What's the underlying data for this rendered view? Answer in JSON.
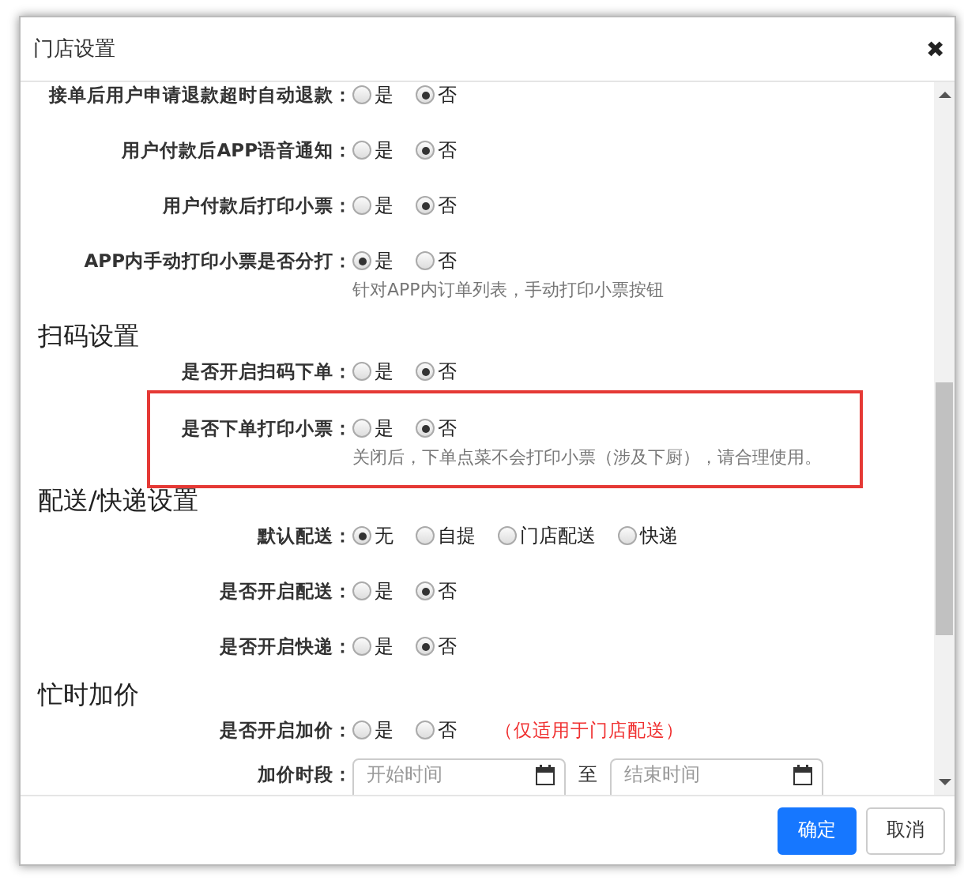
{
  "dialog": {
    "title": "门店设置",
    "close": "✖"
  },
  "sections": [
    {
      "rows": [
        {
          "kind": "radio",
          "label": "接单后用户申请退款超时自动退款：",
          "highlighted": false,
          "options": [
            {
              "label": "是",
              "selected": false
            },
            {
              "label": "否",
              "selected": true
            }
          ]
        },
        {
          "kind": "radio",
          "label": "用户付款后APP语音通知：",
          "highlighted": false,
          "options": [
            {
              "label": "是",
              "selected": false
            },
            {
              "label": "否",
              "selected": true
            }
          ]
        },
        {
          "kind": "radio",
          "label": "用户付款后打印小票：",
          "highlighted": false,
          "options": [
            {
              "label": "是",
              "selected": false
            },
            {
              "label": "否",
              "selected": true
            }
          ]
        },
        {
          "kind": "radio",
          "label": "APP内手动打印小票是否分打：",
          "highlighted": false,
          "options": [
            {
              "label": "是",
              "selected": true
            },
            {
              "label": "否",
              "selected": false
            }
          ],
          "hint": "针对APP内订单列表，手动打印小票按钮"
        }
      ]
    },
    {
      "title": "扫码设置",
      "rows": [
        {
          "kind": "radio",
          "label": "是否开启扫码下单：",
          "highlighted": false,
          "options": [
            {
              "label": "是",
              "selected": false
            },
            {
              "label": "否",
              "selected": true
            }
          ]
        },
        {
          "kind": "radio",
          "label": "是否下单打印小票：",
          "highlighted": true,
          "options": [
            {
              "label": "是",
              "selected": false
            },
            {
              "label": "否",
              "selected": true
            }
          ],
          "hint": "关闭后，下单点菜不会打印小票（涉及下厨），请合理使用。"
        }
      ]
    },
    {
      "title": "配送/快递设置",
      "rows": [
        {
          "kind": "radio",
          "label": "默认配送：",
          "highlighted": false,
          "options": [
            {
              "label": "无",
              "selected": true
            },
            {
              "label": "自提",
              "selected": false
            },
            {
              "label": "门店配送",
              "selected": false
            },
            {
              "label": "快递",
              "selected": false
            }
          ]
        },
        {
          "kind": "radio",
          "label": "是否开启配送：",
          "highlighted": false,
          "options": [
            {
              "label": "是",
              "selected": false
            },
            {
              "label": "否",
              "selected": true
            }
          ]
        },
        {
          "kind": "radio",
          "label": "是否开启快递：",
          "highlighted": false,
          "options": [
            {
              "label": "是",
              "selected": false
            },
            {
              "label": "否",
              "selected": true
            }
          ]
        }
      ]
    },
    {
      "title": "忙时加价",
      "rows": [
        {
          "kind": "radio",
          "label": "是否开启加价：",
          "highlighted": false,
          "options": [
            {
              "label": "是",
              "selected": false
            },
            {
              "label": "否",
              "selected": false
            }
          ],
          "note": "（仅适用于门店配送）"
        },
        {
          "kind": "range",
          "label": "加价时段：",
          "highlighted": false,
          "start_placeholder": "开始时间",
          "separator": "至",
          "end_placeholder": "结束时间"
        }
      ]
    }
  ],
  "buttons": [
    {
      "label": "确定",
      "kind": "primary"
    },
    {
      "label": "取消",
      "kind": "default"
    }
  ]
}
